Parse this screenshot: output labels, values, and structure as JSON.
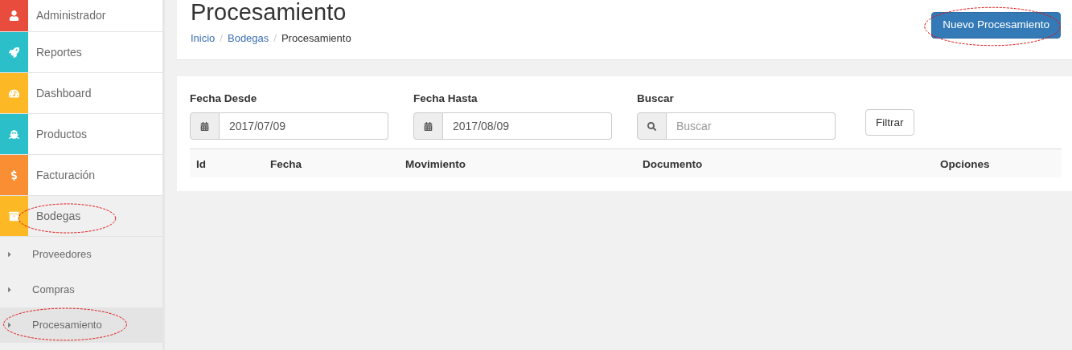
{
  "sidebar": {
    "items": [
      {
        "label": "Administrador",
        "color": "#e84c3d",
        "selected": false,
        "circled": false
      },
      {
        "label": "Reportes",
        "color": "#2bc0c9",
        "selected": false,
        "circled": false
      },
      {
        "label": "Dashboard",
        "color": "#fdb825",
        "selected": false,
        "circled": false
      },
      {
        "label": "Productos",
        "color": "#2bc0c9",
        "selected": false,
        "circled": false
      },
      {
        "label": "Facturación",
        "color": "#f98e33",
        "selected": false,
        "circled": false
      },
      {
        "label": "Bodegas",
        "color": "#fdb825",
        "selected": true,
        "circled": true,
        "children": [
          {
            "label": "Proveedores",
            "selected": false,
            "circled": false
          },
          {
            "label": "Compras",
            "selected": false,
            "circled": false
          },
          {
            "label": "Procesamiento",
            "selected": true,
            "circled": true
          }
        ]
      }
    ]
  },
  "header": {
    "title": "Procesamiento",
    "breadcrumb": [
      {
        "label": "Inicio",
        "link": true
      },
      {
        "separator": "/",
        "label": "Bodegas",
        "link": true
      },
      {
        "separator": "/",
        "label": "Procesamiento",
        "link": false
      }
    ],
    "button": {
      "label": "Nuevo Procesamiento",
      "circled": true
    }
  },
  "filters": {
    "fields": [
      {
        "label": "Fecha Desde",
        "kind": "date",
        "value": "2017/07/09"
      },
      {
        "label": "Fecha Hasta",
        "kind": "date",
        "value": "2017/08/09"
      },
      {
        "label": "Buscar",
        "kind": "search",
        "placeholder": "Buscar"
      }
    ],
    "button": "Filtrar"
  },
  "table": {
    "columns": [
      "Id",
      "Fecha",
      "Movimiento",
      "Documento",
      "Opciones"
    ]
  }
}
